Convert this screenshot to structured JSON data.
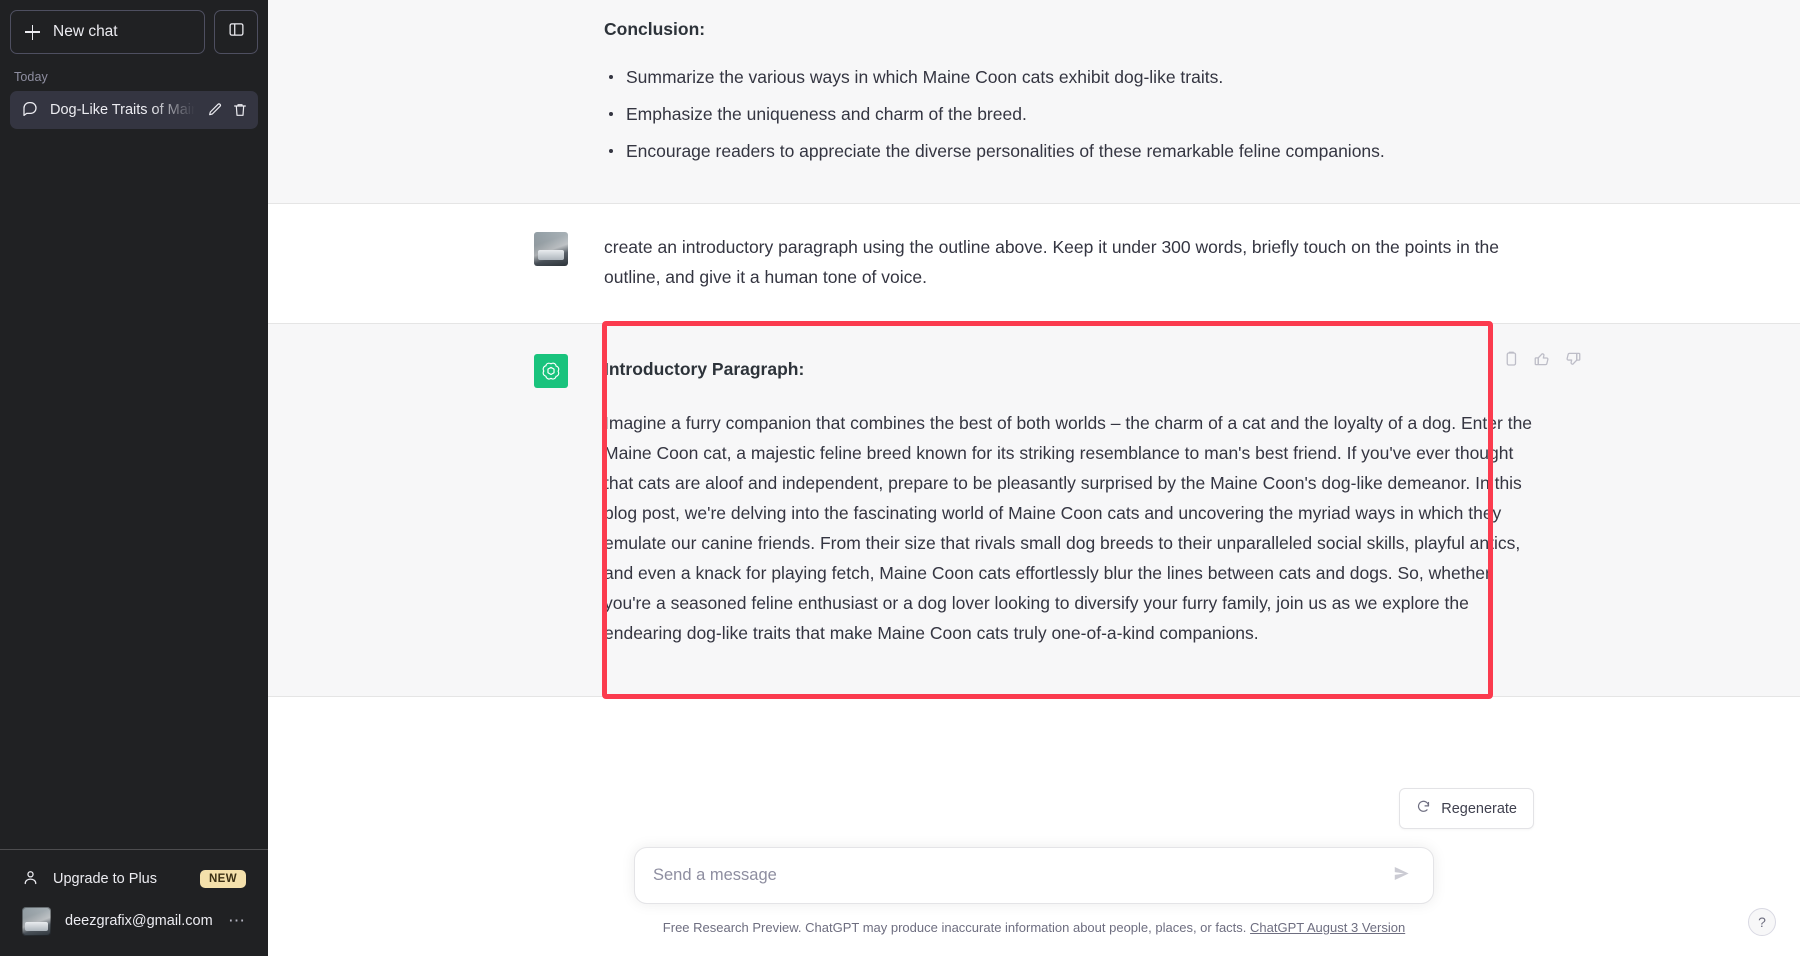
{
  "sidebar": {
    "new_chat_label": "New chat",
    "collapse_icon": "sidebar-toggle-icon",
    "section_label": "Today",
    "chats": [
      {
        "title": "Dog-Like Traits of Main",
        "icon": "chat-bubble-icon",
        "edit_icon": "pencil-icon",
        "delete_icon": "trash-icon"
      }
    ],
    "upgrade": {
      "label": "Upgrade to Plus",
      "badge": "NEW",
      "icon": "person-icon"
    },
    "account": {
      "email": "deezgrafix@gmail.com",
      "menu_icon": "ellipsis-icon"
    }
  },
  "thread": {
    "messages": [
      {
        "role": "assistant",
        "heading": "Conclusion:",
        "bullets": [
          "Summarize the various ways in which Maine Coon cats exhibit dog-like traits.",
          "Emphasize the uniqueness and charm of the breed.",
          "Encourage readers to appreciate the diverse personalities of these remarkable feline companions."
        ]
      },
      {
        "role": "user",
        "text": "create an introductory paragraph using the outline above. Keep it under 300 words, briefly touch on the points in the outline, and give it a human tone of voice."
      },
      {
        "role": "assistant",
        "heading": "Introductory Paragraph:",
        "paragraph": "Imagine a furry companion that combines the best of both worlds – the charm of a cat and the loyalty of a dog. Enter the Maine Coon cat, a majestic feline breed known for its striking resemblance to man's best friend. If you've ever thought that cats are aloof and independent, prepare to be pleasantly surprised by the Maine Coon's dog-like demeanor. In this blog post, we're delving into the fascinating world of Maine Coon cats and uncovering the myriad ways in which they emulate our canine friends. From their size that rivals small dog breeds to their unparalleled social skills, playful antics, and even a knack for playing fetch, Maine Coon cats effortlessly blur the lines between cats and dogs. So, whether you're a seasoned feline enthusiast or a dog lover looking to diversify your furry family, join us as we explore the endearing dog-like traits that make Maine Coon cats truly one-of-a-kind companions.",
        "actions": {
          "copy": "copy-icon",
          "thumbs_up": "thumbs-up-icon",
          "thumbs_down": "thumbs-down-icon"
        }
      }
    ]
  },
  "composer": {
    "regenerate_label": "Regenerate",
    "regenerate_icon": "refresh-icon",
    "input_placeholder": "Send a message",
    "input_value": "",
    "send_icon": "send-icon",
    "disclaimer": "Free Research Preview. ChatGPT may produce inaccurate information about people, places, or facts.",
    "version_link": "ChatGPT August 3 Version",
    "help_label": "?"
  },
  "highlight": {
    "color": "#fb3b4e"
  },
  "colors": {
    "sidebar_bg": "#202123",
    "assistant_bg": "#f7f7f8",
    "user_bg": "#ffffff",
    "brand_green": "#19c37d",
    "badge_yellow": "#f4e0ab"
  }
}
